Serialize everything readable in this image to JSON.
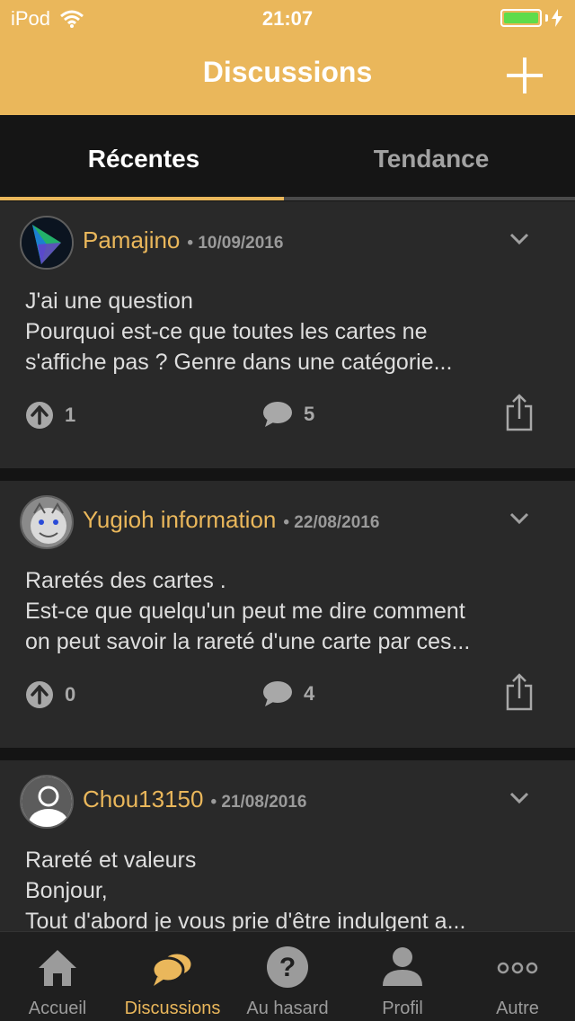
{
  "status_bar": {
    "carrier": "iPod",
    "time": "21:07",
    "battery_color": "#5fdc4b"
  },
  "nav": {
    "title": "Discussions",
    "add_icon": "plus-icon"
  },
  "tabs": [
    {
      "label": "Récentes",
      "active": true
    },
    {
      "label": "Tendance",
      "active": false
    }
  ],
  "posts": [
    {
      "author": "Pamajino",
      "date": "• 10/09/2016",
      "lines": [
        "J'ai une question",
        "Pourquoi est-ce que toutes les cartes ne",
        "s'affiche pas  ? Genre dans une catégorie..."
      ],
      "votes": "1",
      "comments": "5"
    },
    {
      "author": "Yugioh information",
      "date": "• 22/08/2016",
      "lines": [
        "Raretés des cartes .",
        "Est-ce que quelqu'un peut me dire comment",
        "on peut savoir la rareté d'une carte par ces..."
      ],
      "votes": "0",
      "comments": "4"
    },
    {
      "author": "Chou13150",
      "date": "• 21/08/2016",
      "lines": [
        "Rareté et valeurs",
        "Bonjour,",
        "Tout d'abord je vous prie d'être indulgent a..."
      ],
      "votes": "",
      "comments": ""
    }
  ],
  "tabbar": [
    {
      "label": "Accueil",
      "icon": "home-icon",
      "active": false
    },
    {
      "label": "Discussions",
      "icon": "chat-bubbles-icon",
      "active": true
    },
    {
      "label": "Au hasard",
      "icon": "question-icon",
      "active": false
    },
    {
      "label": "Profil",
      "icon": "person-icon",
      "active": false
    },
    {
      "label": "Autre",
      "icon": "more-icon",
      "active": false
    }
  ],
  "colors": {
    "accent": "#eab75b",
    "card": "#292929",
    "background": "#141414"
  }
}
